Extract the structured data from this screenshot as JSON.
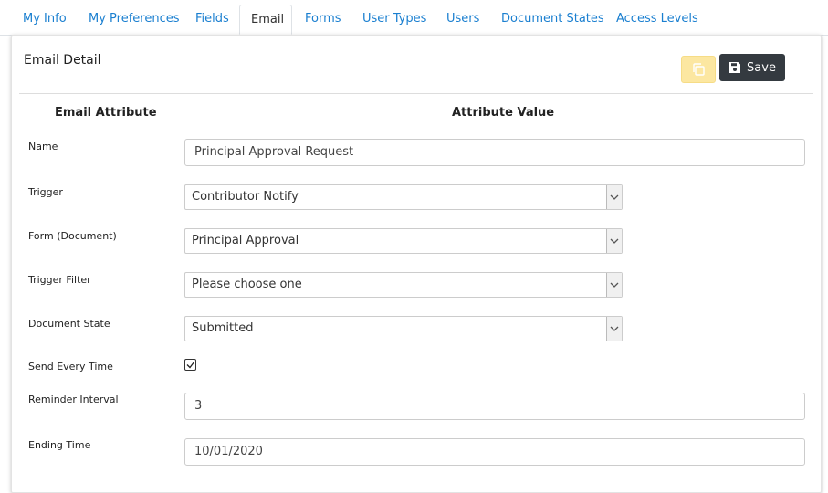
{
  "tabs": [
    "My Info",
    "My Preferences",
    "Fields",
    "Email",
    "Forms",
    "User Types",
    "Users",
    "Document States",
    "Access Levels"
  ],
  "card": {
    "title": "Email Detail",
    "save_label": "Save"
  },
  "table_headers": {
    "attribute": "Email Attribute",
    "value": "Attribute Value"
  },
  "fields": {
    "name": {
      "label": "Name",
      "value": "Principal Approval Request"
    },
    "trigger": {
      "label": "Trigger",
      "value": "Contributor Notify"
    },
    "form": {
      "label": "Form (Document)",
      "value": "Principal Approval"
    },
    "trigger_filter": {
      "label": "Trigger Filter",
      "value": "Please choose one"
    },
    "document_state": {
      "label": "Document State",
      "value": "Submitted"
    },
    "send_every_time": {
      "label": "Send Every Time",
      "checked": true
    },
    "reminder_interval": {
      "label": "Reminder Interval",
      "value": "3"
    },
    "ending_time": {
      "label": "Ending Time",
      "value": "10/01/2020"
    }
  },
  "colors": {
    "link": "#1a7fd0",
    "save_button": "#343a40",
    "copy_button": "#fce7a1"
  },
  "icons": {
    "copy": "copy-icon",
    "save": "floppy-disk-icon",
    "select_arrow": "chevron-down-icon",
    "checkbox": "checkmark-icon"
  }
}
